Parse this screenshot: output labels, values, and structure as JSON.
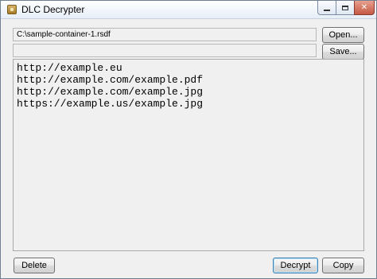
{
  "window": {
    "title": "DLC Decrypter",
    "icon": "app-icon",
    "controls": {
      "minimize_icon": "minimize-icon",
      "maximize_icon": "maximize-icon",
      "close_icon": "close-icon",
      "close_glyph": "✕"
    }
  },
  "main": {
    "input_path": "C:\\sample-container-1.rsdf",
    "output_path": "",
    "open_label": "Open...",
    "save_label": "Save...",
    "links": [
      "http://example.eu",
      "http://example.com/example.pdf",
      "http://example.com/example.jpg",
      "https://example.us/example.jpg"
    ]
  },
  "footer": {
    "delete_label": "Delete",
    "decrypt_label": "Decrypt",
    "copy_label": "Copy"
  },
  "colors": {
    "window_bg": "#f0f0f0",
    "close_button": "#c45a44"
  }
}
